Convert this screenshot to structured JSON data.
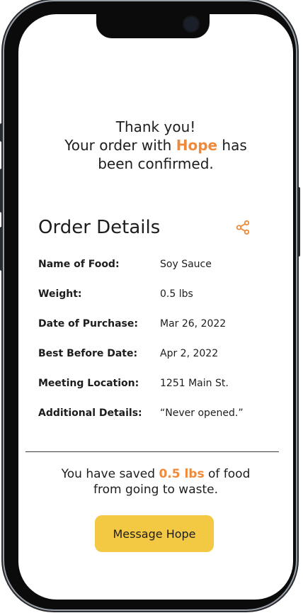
{
  "confirmation": {
    "line1": "Thank you!",
    "line2_prefix": "Your order with ",
    "name": "Hope",
    "line2_suffix": " has",
    "line3": "been confirmed."
  },
  "details": {
    "title": "Order Details",
    "rows": [
      {
        "label": "Name of Food:",
        "value": "Soy Sauce"
      },
      {
        "label": "Weight:",
        "value": "0.5 lbs"
      },
      {
        "label": "Date of Purchase:",
        "value": "Mar 26, 2022"
      },
      {
        "label": "Best Before Date:",
        "value": "Apr 2, 2022"
      },
      {
        "label": "Meeting Location:",
        "value": "1251 Main St."
      },
      {
        "label": "Additional Details:",
        "value": "“Never opened.”"
      }
    ]
  },
  "saved": {
    "prefix": "You have saved ",
    "amount": "0.5 lbs",
    "suffix": " of food",
    "line2": "from going to waste."
  },
  "actions": {
    "message_label": "Message Hope"
  },
  "colors": {
    "accent": "#ef8a3a",
    "button": "#f3c842"
  },
  "icons": {
    "share": "share-icon"
  }
}
